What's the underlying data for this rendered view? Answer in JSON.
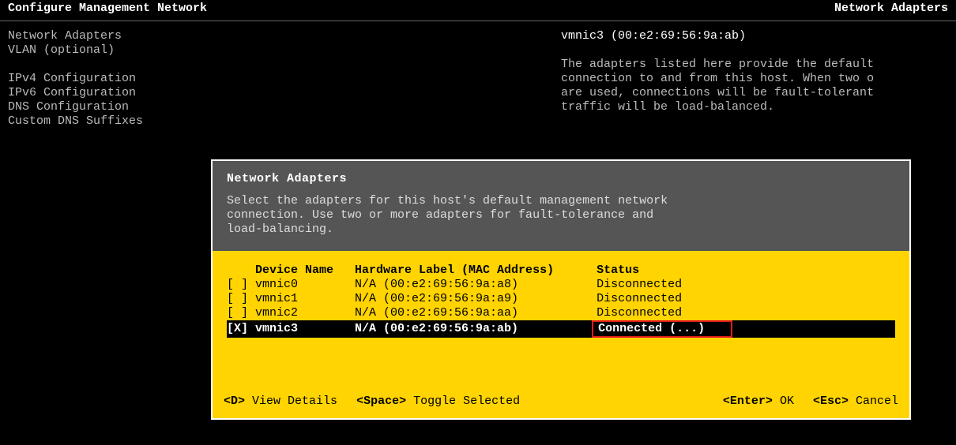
{
  "header": {
    "left_title": "Configure Management Network",
    "right_title": "Network Adapters"
  },
  "left_menu": {
    "items": [
      "Network Adapters",
      "VLAN (optional)",
      "",
      "IPv4 Configuration",
      "IPv6 Configuration",
      "DNS Configuration",
      "Custom DNS Suffixes"
    ]
  },
  "right_panel": {
    "title": "vmnic3 (00:e2:69:56:9a:ab)",
    "body_lines": [
      "The adapters listed here provide the default",
      "connection to and from this host. When two o",
      "are used, connections will be fault-tolerant",
      "traffic will be load-balanced."
    ]
  },
  "dialog": {
    "title": "Network Adapters",
    "description_lines": [
      "Select the adapters for this host's default management network",
      "connection. Use two or more adapters for fault-tolerance and",
      "load-balancing."
    ],
    "columns": {
      "device": "Device Name",
      "hw": "Hardware Label (MAC Address)",
      "status": "Status"
    },
    "rows": [
      {
        "checked": false,
        "device": "vmnic0",
        "hw": "N/A (00:e2:69:56:9a:a8)",
        "status": "Disconnected",
        "selected": false
      },
      {
        "checked": false,
        "device": "vmnic1",
        "hw": "N/A (00:e2:69:56:9a:a9)",
        "status": "Disconnected",
        "selected": false
      },
      {
        "checked": false,
        "device": "vmnic2",
        "hw": "N/A (00:e2:69:56:9a:aa)",
        "status": "Disconnected",
        "selected": false
      },
      {
        "checked": true,
        "device": "vmnic3",
        "hw": "N/A (00:e2:69:56:9a:ab)",
        "status": "Connected (...)",
        "selected": true
      }
    ],
    "footer": {
      "view_key": "<D>",
      "view_label": "View Details",
      "toggle_key": "<Space>",
      "toggle_label": "Toggle Selected",
      "ok_key": "<Enter>",
      "ok_label": "OK",
      "cancel_key": "<Esc>",
      "cancel_label": "Cancel"
    }
  }
}
